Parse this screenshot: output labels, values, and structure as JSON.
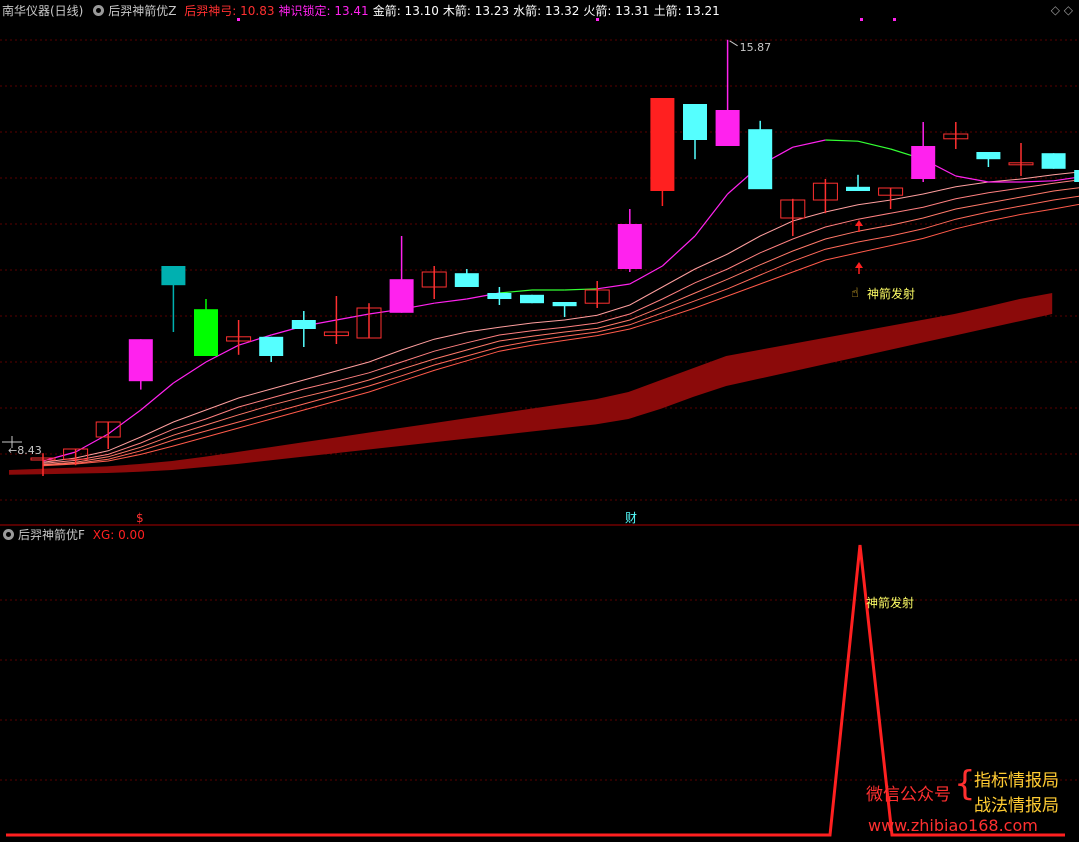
{
  "colors": {
    "up": "#ff3030",
    "down": "#55ffff",
    "limit_up": "#ff2020",
    "cyan_dark": "#00b0b0",
    "magenta": "#ff22ee",
    "green": "#00ff00",
    "band": "#8b0a0a",
    "grid": "#5a0000",
    "text_gray": "#c8c8c8",
    "yellow": "#ffff00",
    "osc_line": "#ff2020"
  },
  "top_panel": {
    "title": "南华仪器(日线)",
    "indicator": "后羿神箭优Z",
    "legend": [
      {
        "label": "后羿神弓: 10.83",
        "color": "#ff3030"
      },
      {
        "label": "神识锁定: 13.41",
        "color": "#ff22ee"
      },
      {
        "label": "金箭: 13.10",
        "color": "#ffffff"
      },
      {
        "label": "木箭: 13.23",
        "color": "#ffffff"
      },
      {
        "label": "水箭: 13.32",
        "color": "#ffffff"
      },
      {
        "label": "火箭: 13.31",
        "color": "#ffffff"
      },
      {
        "label": "土箭: 13.21",
        "color": "#ffffff"
      }
    ],
    "high_label": "15.87",
    "low_label": "8.43",
    "signal_label": "神箭发射",
    "event_labels": [
      "$",
      "财"
    ]
  },
  "bottom_panel": {
    "indicator": "后羿神箭优F",
    "legend": {
      "label": "XG: 0.00",
      "color": "#ff2020"
    },
    "signal_label": "神箭发射"
  },
  "watermark": {
    "left": "微信公众号",
    "right_top": "指标情报局",
    "right_bottom": "战法情报局",
    "url": "www.zhibiao168.com"
  },
  "chart_data": [
    {
      "type": "candlestick",
      "title": "南华仪器(日线)",
      "ylim": [
        8.2,
        16.2
      ],
      "candles": [
        {
          "o": 8.9,
          "h": 8.98,
          "l": 8.6,
          "c": 8.9,
          "s": "red"
        },
        {
          "o": 8.88,
          "h": 9.05,
          "l": 8.78,
          "c": 9.05,
          "s": "red"
        },
        {
          "o": 9.25,
          "h": 9.5,
          "l": 9.05,
          "c": 9.5,
          "s": "red"
        },
        {
          "o": 10.18,
          "h": 10.88,
          "l": 10.04,
          "c": 10.88,
          "s": "magenta"
        },
        {
          "o": 12.1,
          "h": 12.1,
          "l": 11.0,
          "c": 11.78,
          "s": "cyan_dark"
        },
        {
          "o": 10.6,
          "h": 11.55,
          "l": 10.6,
          "c": 11.38,
          "s": "green"
        },
        {
          "o": 10.85,
          "h": 11.2,
          "l": 10.62,
          "c": 10.92,
          "s": "red"
        },
        {
          "o": 10.92,
          "h": 10.92,
          "l": 10.5,
          "c": 10.6,
          "s": "cyan"
        },
        {
          "o": 11.2,
          "h": 11.35,
          "l": 10.75,
          "c": 11.05,
          "s": "cyan"
        },
        {
          "o": 10.94,
          "h": 11.6,
          "l": 10.8,
          "c": 11.0,
          "s": "red"
        },
        {
          "o": 10.9,
          "h": 11.48,
          "l": 10.9,
          "c": 11.4,
          "s": "red"
        },
        {
          "o": 11.32,
          "h": 12.6,
          "l": 11.32,
          "c": 11.88,
          "s": "magenta"
        },
        {
          "o": 11.75,
          "h": 12.1,
          "l": 11.55,
          "c": 12.0,
          "s": "red"
        },
        {
          "o": 11.98,
          "h": 12.05,
          "l": 11.75,
          "c": 11.75,
          "s": "cyan"
        },
        {
          "o": 11.65,
          "h": 11.75,
          "l": 11.45,
          "c": 11.55,
          "s": "cyan"
        },
        {
          "o": 11.62,
          "h": 11.62,
          "l": 11.48,
          "c": 11.48,
          "s": "cyan"
        },
        {
          "o": 11.5,
          "h": 11.5,
          "l": 11.25,
          "c": 11.43,
          "s": "cyan"
        },
        {
          "o": 11.48,
          "h": 11.85,
          "l": 11.4,
          "c": 11.7,
          "s": "red"
        },
        {
          "o": 12.05,
          "h": 13.05,
          "l": 12.0,
          "c": 12.8,
          "s": "magenta"
        },
        {
          "o": 13.35,
          "h": 14.9,
          "l": 13.1,
          "c": 14.9,
          "s": "limit_up"
        },
        {
          "o": 14.8,
          "h": 14.8,
          "l": 13.88,
          "c": 14.2,
          "s": "cyan"
        },
        {
          "o": 14.1,
          "h": 15.87,
          "l": 14.1,
          "c": 14.7,
          "s": "magenta"
        },
        {
          "o": 14.38,
          "h": 14.52,
          "l": 13.4,
          "c": 13.38,
          "s": "cyan"
        },
        {
          "o": 12.9,
          "h": 13.22,
          "l": 12.6,
          "c": 13.2,
          "s": "red"
        },
        {
          "o": 13.2,
          "h": 13.55,
          "l": 12.98,
          "c": 13.48,
          "s": "red"
        },
        {
          "o": 13.42,
          "h": 13.62,
          "l": 13.35,
          "c": 13.35,
          "s": "cyan"
        },
        {
          "o": 13.4,
          "h": 13.4,
          "l": 13.05,
          "c": 13.28,
          "s": "red"
        },
        {
          "o": 13.55,
          "h": 14.5,
          "l": 13.5,
          "c": 14.1,
          "s": "magenta"
        },
        {
          "o": 14.22,
          "h": 14.5,
          "l": 14.05,
          "c": 14.3,
          "s": "red"
        },
        {
          "o": 14.0,
          "h": 14.0,
          "l": 13.75,
          "c": 13.88,
          "s": "cyan"
        },
        {
          "o": 13.8,
          "h": 14.15,
          "l": 13.6,
          "c": 13.82,
          "s": "red"
        },
        {
          "o": 13.98,
          "h": 13.98,
          "l": 13.72,
          "c": 13.72,
          "s": "cyan"
        },
        {
          "o": 13.7,
          "h": 13.75,
          "l": 13.5,
          "c": 13.5,
          "s": "cyan"
        }
      ],
      "ma_magenta": [
        8.85,
        9.0,
        9.3,
        9.7,
        10.15,
        10.5,
        10.78,
        10.95,
        11.1,
        11.2,
        11.3,
        11.38,
        11.48,
        11.55,
        11.65,
        11.7,
        11.7,
        11.72,
        11.8,
        12.1,
        12.6,
        13.3,
        13.78,
        14.08,
        14.2,
        14.18,
        14.05,
        13.88,
        13.6,
        13.5,
        13.5,
        13.52,
        13.6
      ],
      "ma_fans": [
        [
          8.83,
          8.9,
          9.02,
          9.25,
          9.5,
          9.7,
          9.9,
          10.05,
          10.2,
          10.35,
          10.5,
          10.7,
          10.88,
          11.0,
          11.08,
          11.15,
          11.2,
          11.28,
          11.45,
          11.75,
          12.05,
          12.3,
          12.6,
          12.85,
          13.0,
          13.12,
          13.2,
          13.3,
          13.42,
          13.5,
          13.55,
          13.62,
          13.68
        ],
        [
          8.81,
          8.86,
          8.96,
          9.15,
          9.38,
          9.55,
          9.75,
          9.9,
          10.05,
          10.18,
          10.32,
          10.5,
          10.68,
          10.82,
          10.95,
          11.02,
          11.08,
          11.15,
          11.3,
          11.55,
          11.82,
          12.05,
          12.32,
          12.55,
          12.75,
          12.88,
          12.98,
          13.08,
          13.22,
          13.32,
          13.4,
          13.48,
          13.55
        ],
        [
          8.79,
          8.83,
          8.92,
          9.08,
          9.28,
          9.45,
          9.62,
          9.78,
          9.92,
          10.05,
          10.2,
          10.38,
          10.55,
          10.7,
          10.85,
          10.93,
          11.0,
          11.06,
          11.2,
          11.42,
          11.65,
          11.88,
          12.12,
          12.35,
          12.55,
          12.68,
          12.78,
          12.9,
          13.05,
          13.15,
          13.25,
          13.35,
          13.42
        ],
        [
          8.78,
          8.81,
          8.88,
          9.02,
          9.2,
          9.35,
          9.5,
          9.65,
          9.8,
          9.95,
          10.1,
          10.27,
          10.45,
          10.6,
          10.75,
          10.85,
          10.93,
          11.0,
          11.12,
          11.32,
          11.52,
          11.72,
          11.95,
          12.18,
          12.38,
          12.5,
          12.6,
          12.72,
          12.88,
          13.0,
          13.1,
          13.2,
          13.28
        ],
        [
          8.77,
          8.8,
          8.85,
          8.96,
          9.1,
          9.25,
          9.4,
          9.55,
          9.7,
          9.85,
          10.0,
          10.18,
          10.36,
          10.52,
          10.68,
          10.78,
          10.86,
          10.94,
          11.05,
          11.22,
          11.4,
          11.6,
          11.8,
          12.0,
          12.2,
          12.32,
          12.44,
          12.56,
          12.72,
          12.85,
          12.96,
          13.05,
          13.15
        ]
      ],
      "band_upper": [
        8.7,
        8.72,
        8.74,
        8.76,
        8.8,
        8.85,
        8.92,
        9.0,
        9.08,
        9.16,
        9.24,
        9.32,
        9.4,
        9.48,
        9.56,
        9.64,
        9.72,
        9.8,
        9.88,
        10.0,
        10.2,
        10.4,
        10.6,
        10.7,
        10.8,
        10.9,
        11.0,
        11.1,
        11.2,
        11.3,
        11.42,
        11.55,
        11.65
      ],
      "band_lower": [
        8.62,
        8.63,
        8.64,
        8.65,
        8.67,
        8.7,
        8.75,
        8.8,
        8.86,
        8.92,
        8.98,
        9.04,
        9.1,
        9.16,
        9.22,
        9.28,
        9.34,
        9.4,
        9.46,
        9.55,
        9.72,
        9.92,
        10.1,
        10.22,
        10.34,
        10.46,
        10.58,
        10.7,
        10.82,
        10.94,
        11.06,
        11.18,
        11.3
      ],
      "signal_arrows_at": [
        25
      ],
      "event_at": [
        4,
        19
      ]
    },
    {
      "type": "line",
      "title": "后羿神箭优F",
      "series": [
        {
          "name": "XG",
          "values": [
            0,
            0,
            0,
            0,
            0,
            0,
            0,
            0,
            0,
            0,
            0,
            0,
            0,
            0,
            0,
            0,
            0,
            0,
            0,
            0,
            0,
            0,
            0,
            0,
            0,
            1,
            0,
            0,
            0,
            0,
            0,
            0,
            0
          ]
        }
      ],
      "ylim": [
        0,
        1
      ]
    }
  ]
}
